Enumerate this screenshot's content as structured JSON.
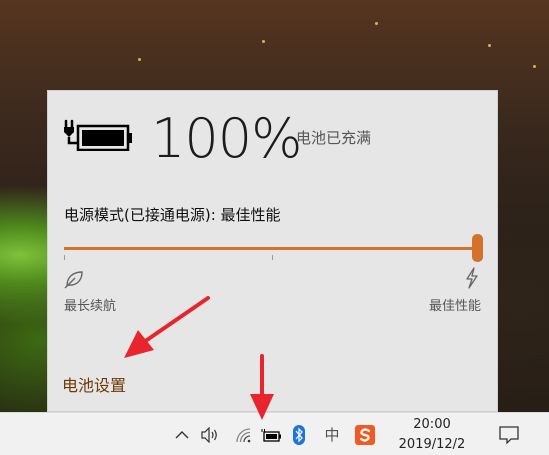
{
  "battery": {
    "percent_text": "100%",
    "status": "电池已充满"
  },
  "power_mode": {
    "label": "电源模式(已接通电源): 最佳性能",
    "left_label": "最长续航",
    "right_label": "最佳性能",
    "level": 1.0
  },
  "links": {
    "battery_settings": "电池设置"
  },
  "taskbar": {
    "ime": "中",
    "time": "20:00",
    "date": "2019/12/2",
    "icons": [
      "chevron-up-icon",
      "volume-icon",
      "wifi-icon",
      "battery-icon",
      "bluetooth-icon",
      "ime-indicator",
      "sogou-icon",
      "notification-icon"
    ]
  },
  "colors": {
    "accent": "#d2722c",
    "link": "#6b3a07",
    "annotation_arrow": "#e8242c"
  }
}
